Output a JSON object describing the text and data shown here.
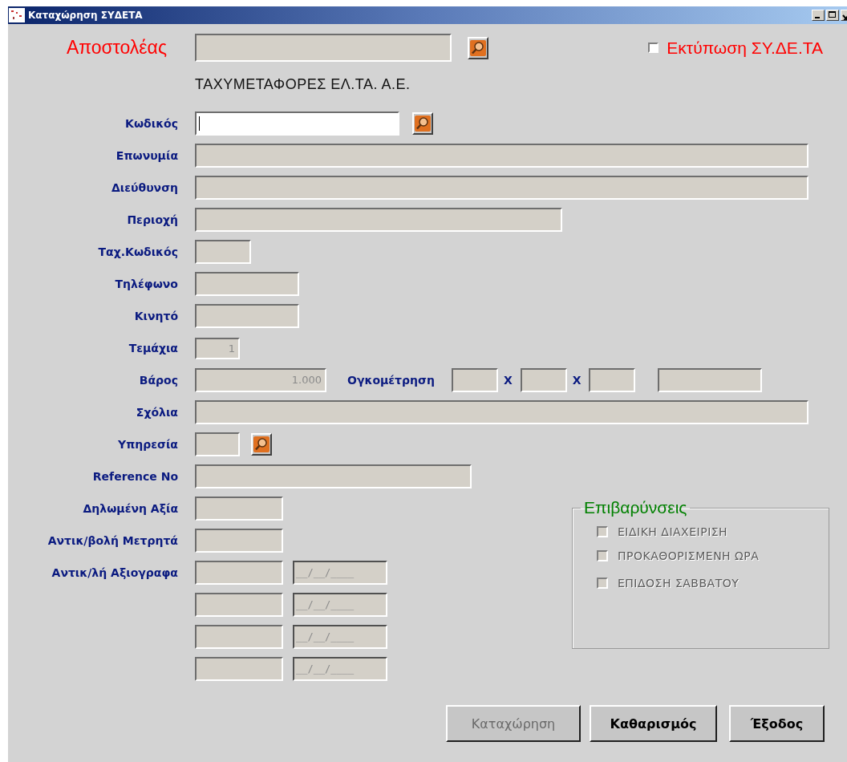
{
  "window": {
    "title": "Καταχώρηση ΣΥΔΕΤΑ"
  },
  "header": {
    "sender_label": "Αποστολέας",
    "sender_field": {
      "disabled": true
    },
    "print_checkbox": {
      "label": "Εκτύπωση ΣΥ.ΔΕ.ΤΑ",
      "checked": false
    },
    "company_name": "ΤΑΧΥΜΕΤΑΦΟΡΕΣ ΕΛ.ΤΑ. Α.Ε."
  },
  "fields": [
    {
      "label": "Κωδικός",
      "parts": [
        {
          "kind": "input",
          "disabled": false,
          "focused": true
        },
        {
          "kind": "lookup"
        }
      ]
    },
    {
      "label": "Επωνυμία",
      "parts": [
        {
          "kind": "input",
          "disabled": true
        }
      ]
    },
    {
      "label": "Διεύθυνση",
      "parts": [
        {
          "kind": "input",
          "disabled": true
        }
      ]
    },
    {
      "label": "Περιοχή",
      "parts": [
        {
          "kind": "input",
          "disabled": true
        }
      ]
    },
    {
      "label": "Ταχ.Κωδικός",
      "parts": [
        {
          "kind": "input",
          "disabled": true
        }
      ]
    },
    {
      "label": "Τηλέφωνο",
      "parts": [
        {
          "kind": "input",
          "disabled": true
        }
      ]
    },
    {
      "label": "Κινητό",
      "parts": [
        {
          "kind": "input",
          "disabled": true
        }
      ]
    },
    {
      "label": "Τεμάχια",
      "parts": [
        {
          "kind": "input",
          "disabled": true,
          "value": "1"
        }
      ]
    },
    {
      "label": "Βάρος",
      "parts": [
        {
          "kind": "input",
          "disabled": true,
          "value": "1.000"
        },
        {
          "kind": "text",
          "text": "Ογκομέτρηση"
        },
        {
          "kind": "input",
          "disabled": true
        },
        {
          "kind": "text",
          "text": "X"
        },
        {
          "kind": "input",
          "disabled": true
        },
        {
          "kind": "text",
          "text": "X"
        },
        {
          "kind": "input",
          "disabled": true
        },
        {
          "kind": "input",
          "disabled": true
        }
      ]
    },
    {
      "label": "Σχόλια",
      "parts": [
        {
          "kind": "input",
          "disabled": true
        }
      ]
    },
    {
      "label": "Υπηρεσία",
      "parts": [
        {
          "kind": "input",
          "disabled": true
        },
        {
          "kind": "lookup"
        }
      ]
    },
    {
      "label": "Reference No",
      "parts": [
        {
          "kind": "input",
          "disabled": true
        }
      ]
    }
  ],
  "value_fields": [
    {
      "label": "Δηλωμένη Αξία",
      "parts": [
        {
          "kind": "input",
          "disabled": true
        }
      ]
    },
    {
      "label": "Αντικ/βολή Μετρητά",
      "parts": [
        {
          "kind": "input",
          "disabled": true
        }
      ]
    },
    {
      "label": "Αντικ/λή Αξιογραφα",
      "parts": [
        {
          "kind": "input",
          "disabled": true
        },
        {
          "kind": "date",
          "disabled": true,
          "value": "__/__/____"
        }
      ]
    },
    {
      "parts": [
        {
          "kind": "input",
          "disabled": true
        },
        {
          "kind": "date",
          "disabled": true,
          "value": "__/__/____"
        }
      ]
    },
    {
      "parts": [
        {
          "kind": "input",
          "disabled": true
        },
        {
          "kind": "date",
          "disabled": true,
          "value": "__/__/____"
        }
      ]
    },
    {
      "parts": [
        {
          "kind": "input",
          "disabled": true
        },
        {
          "kind": "date",
          "disabled": true,
          "value": "__/__/____"
        }
      ]
    }
  ],
  "charges": {
    "title": "Επιβαρύνσεις",
    "options": [
      {
        "label": "ΕΙΔΙΚΗ ΔΙΑΧΕΙΡΙΣΗ",
        "checked": false,
        "disabled": true
      },
      {
        "label": "ΠΡΟΚΑΘΟΡΙΣΜΕΝΗ ΩΡΑ",
        "checked": false,
        "disabled": true
      },
      {
        "label": "ΕΠΙΔΟΣΗ ΣΑΒΒΑΤΟΥ",
        "checked": false,
        "disabled": true
      }
    ]
  },
  "buttons": [
    {
      "label": "Καταχώρηση",
      "disabled": true
    },
    {
      "label": "Καθαρισμός",
      "disabled": false
    },
    {
      "label": "Έξοδος",
      "disabled": false
    }
  ]
}
